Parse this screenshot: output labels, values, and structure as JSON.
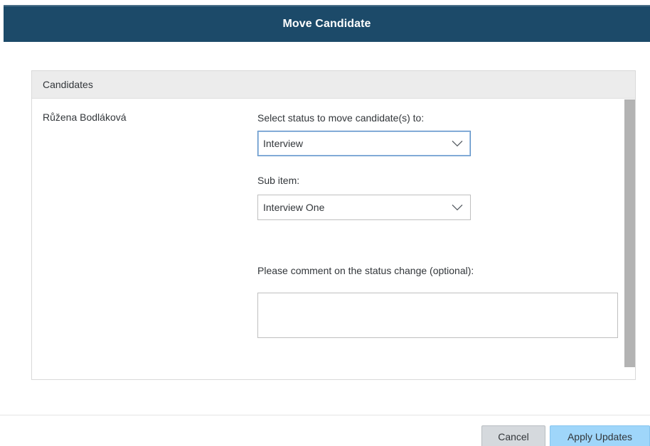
{
  "dialog": {
    "title": "Move Candidate"
  },
  "panel": {
    "header": "Candidates",
    "candidate_name": "Růžena Bodláková",
    "status_label": "Select status to move candidate(s) to:",
    "status_value": "Interview",
    "sub_item_label": "Sub item:",
    "sub_item_value": "Interview One",
    "comment_label": "Please comment on the status change (optional):",
    "comment_value": ""
  },
  "footer": {
    "cancel_label": "Cancel",
    "apply_label": "Apply Updates"
  },
  "icons": {
    "dropdown": "chevron-down-icon"
  },
  "colors": {
    "title_bar": "#1c4a69",
    "apply_button": "#9fd6fa",
    "cancel_button": "#d5d9dd"
  }
}
